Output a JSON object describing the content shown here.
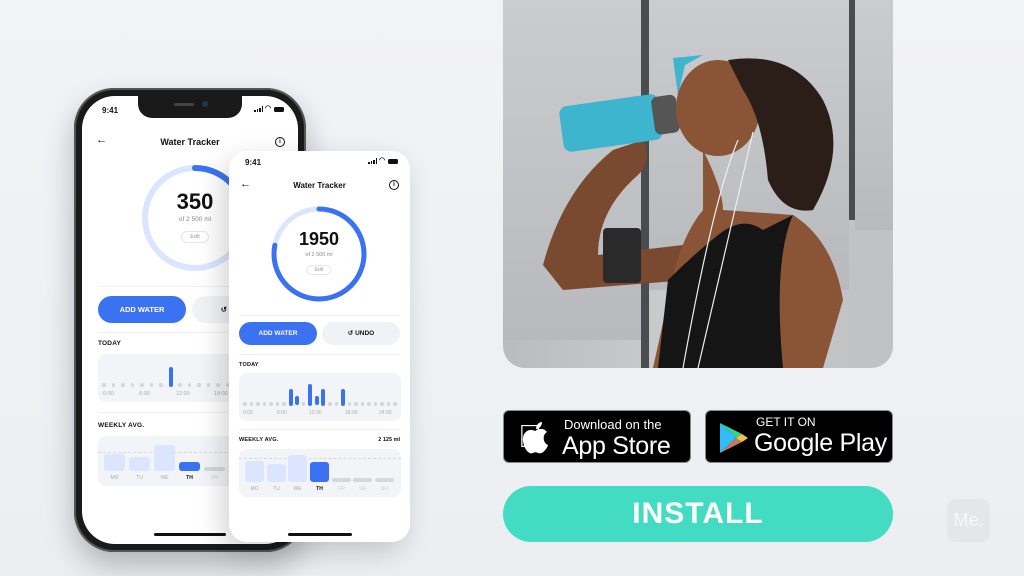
{
  "app": {
    "title": "Water Tracker"
  },
  "status_bar": {
    "time": "9:41"
  },
  "back_phone": {
    "current_ml": "350",
    "goal_label": "of 2 500 ml",
    "progress": 0.14,
    "edit_label": "Edit",
    "add_label": "ADD WATER",
    "undo_label": "UNDO",
    "today_label": "TODAY",
    "today_ticks": [
      "0:00",
      "6:00",
      "12:00",
      "18:00"
    ],
    "today_bars": [
      {
        "hour": 7,
        "level": 1.0
      }
    ],
    "weekly_label": "WEEKLY AVG.",
    "weekly_days": [
      "MO",
      "TU",
      "WE",
      "TH",
      "FR"
    ]
  },
  "front_phone": {
    "current_ml": "1950",
    "goal_label": "of 2 500 ml",
    "progress": 0.78,
    "edit_label": "Edit",
    "add_label": "ADD WATER",
    "undo_label": "UNDO",
    "today_label": "TODAY",
    "today_ticks": [
      "0:00",
      "6:00",
      "12:00",
      "18:00",
      "24:00"
    ],
    "today_bars": [
      {
        "hour": 7,
        "level": 0.75
      },
      {
        "hour": 8,
        "level": 0.45
      },
      {
        "hour": 10,
        "level": 1.0
      },
      {
        "hour": 11,
        "level": 0.45
      },
      {
        "hour": 12,
        "level": 0.75
      },
      {
        "hour": 15,
        "level": 0.75
      }
    ],
    "weekly_label": "WEEKLY AVG.",
    "weekly_value": "2 125 ml",
    "weekly_days": [
      "MO",
      "TU",
      "WE",
      "TH",
      "FR",
      "SA",
      "SU"
    ],
    "weekly_values_ml": [
      2250,
      1900,
      2900,
      2100,
      0,
      0,
      0
    ],
    "weekly_avg_ml": 2125,
    "current_day": "TH"
  },
  "colors": {
    "accent": "#3a72f2",
    "ring_track": "#dbe5fd",
    "install": "#43dcc3"
  },
  "stores": {
    "apple_small": "Download on the",
    "apple_big": "App Store",
    "google_small": "GET IT ON",
    "google_big": "Google Play"
  },
  "install_label": "INSTALL",
  "brand_logo": "Me."
}
